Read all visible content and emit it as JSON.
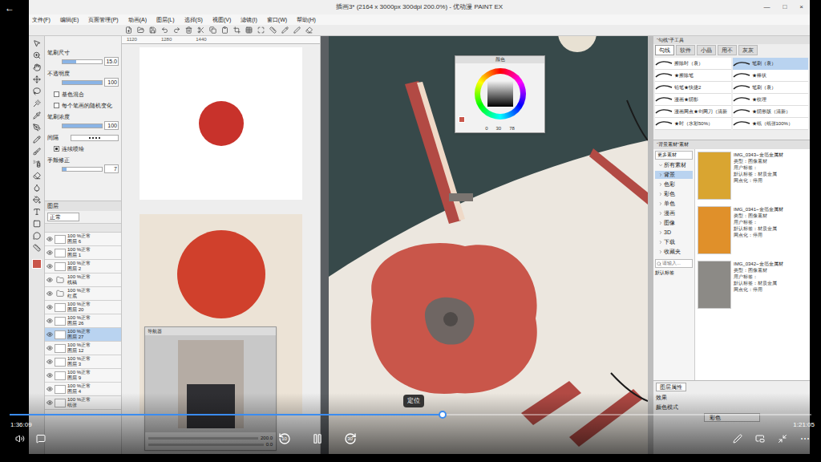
{
  "player": {
    "back": "←",
    "current_time": "1:36:09",
    "total_time": "1:21:05",
    "tooltip": "定位",
    "level": 0.54,
    "rewind_seconds": "10",
    "forward_seconds": "30",
    "more": "⋯"
  },
  "app": {
    "title": "插画3* (2164 x 3000px 300dpi 200.0%) - 优动漫 PAINT EX",
    "window_buttons": [
      "—",
      "□",
      "×"
    ],
    "menu": [
      "文件(F)",
      "编辑(E)",
      "页面管理(P)",
      "动画(A)",
      "图层(L)",
      "选择(S)",
      "视图(V)",
      "滤镜(I)",
      "窗口(W)",
      "帮助(H)"
    ]
  },
  "tool_property": {
    "rows": [
      {
        "kind": "slider",
        "label": "笔刷尺寸",
        "value": "15.0",
        "level": 0.35
      },
      {
        "kind": "slider",
        "label": "不透明度",
        "value": "100",
        "level": 1
      },
      {
        "kind": "checkbox",
        "label": "基色混合",
        "checked": false
      },
      {
        "kind": "checkbox",
        "label": "每个笔画的随机变化",
        "checked": false
      },
      {
        "kind": "slider",
        "label": "笔刷浓度",
        "value": "100",
        "level": 1
      },
      {
        "kind": "pattern",
        "label": "间隔"
      },
      {
        "kind": "checkbox",
        "label": "连续喷绘",
        "checked": true
      },
      {
        "kind": "slider",
        "label": "手颤修正",
        "value": "7",
        "level": 0.1
      }
    ]
  },
  "layers": {
    "title": "图层",
    "blend": "正常",
    "rows": [
      {
        "kind": "layer",
        "opacity": "100 %正常",
        "name": "图层 6",
        "visible": true,
        "selected": false
      },
      {
        "kind": "layer",
        "opacity": "100 %正常",
        "name": "图层 1",
        "visible": true,
        "selected": false
      },
      {
        "kind": "layer",
        "opacity": "100 %正常",
        "name": "图层 2",
        "visible": true,
        "selected": false
      },
      {
        "kind": "folder",
        "opacity": "100 %正常",
        "name": "线稿",
        "visible": true,
        "selected": false
      },
      {
        "kind": "folder",
        "opacity": "100 %正常",
        "name": "红底",
        "visible": true,
        "selected": false
      },
      {
        "kind": "layer",
        "opacity": "100 %正常",
        "name": "图层 20",
        "visible": true,
        "selected": false
      },
      {
        "kind": "layer",
        "opacity": "100 %正常",
        "name": "图层 26",
        "visible": true,
        "selected": false
      },
      {
        "kind": "layer",
        "opacity": "100 %正常",
        "name": "图层 27",
        "visible": true,
        "selected": true
      },
      {
        "kind": "layer",
        "opacity": "100 %正常",
        "name": "图层 12",
        "visible": true,
        "selected": false
      },
      {
        "kind": "layer",
        "opacity": "100 %正常",
        "name": "图层 3",
        "visible": true,
        "selected": false
      },
      {
        "kind": "layer",
        "opacity": "100 %正常",
        "name": "图层 9",
        "visible": true,
        "selected": false
      },
      {
        "kind": "layer",
        "opacity": "100 %正常",
        "name": "图层 4",
        "visible": true,
        "selected": false
      },
      {
        "kind": "layer",
        "opacity": "100 %正常",
        "name": "纸张",
        "visible": true,
        "selected": false
      }
    ]
  },
  "reference": {
    "ruler": [
      "1120",
      "1280",
      "1440"
    ]
  },
  "navigator": {
    "title": "导航器",
    "zoom": "200.0",
    "angle": "0.0"
  },
  "color_popup": {
    "title": "颜色",
    "values": [
      "0",
      "30",
      "78"
    ]
  },
  "subtool": {
    "title": "“勾线”子工具",
    "tabs": [
      {
        "label": "勾线",
        "selected": true
      },
      {
        "label": "软件",
        "selected": false
      },
      {
        "label": "小晶",
        "selected": false
      },
      {
        "label": "用不",
        "selected": false
      },
      {
        "label": "灰灰",
        "selected": false
      }
    ],
    "brushes": [
      {
        "name": "擦除时（衰）",
        "selected": false
      },
      {
        "name": "笔刷（衰）",
        "selected": true
      },
      {
        "name": "★擦除笔",
        "selected": false
      },
      {
        "name": "★棒状",
        "selected": false
      },
      {
        "name": "铅笔★快捷2",
        "selected": false
      },
      {
        "name": "笔刷（衰）",
        "selected": false
      },
      {
        "name": "漫画★阴影",
        "selected": false
      },
      {
        "name": "★纹理",
        "selected": false
      },
      {
        "name": "漫画网点★剑网刀（清新",
        "selected": false
      },
      {
        "name": "★阴形版（清新）",
        "selected": false
      },
      {
        "name": "★时（水彩50%）",
        "selected": false
      },
      {
        "name": "★纸（纸张100%）",
        "selected": false
      }
    ]
  },
  "materials": {
    "title": "“背景素材”素材",
    "more": "更多素材",
    "tree": [
      {
        "label": "所有素材",
        "expanded": true,
        "selected": false
      },
      {
        "label": "背景",
        "expanded": false,
        "selected": true
      },
      {
        "label": "色彩",
        "expanded": false,
        "selected": false
      },
      {
        "label": "彩色",
        "expanded": false,
        "selected": false
      },
      {
        "label": "单色",
        "expanded": false,
        "selected": false
      },
      {
        "label": "漫画",
        "expanded": false,
        "selected": false
      },
      {
        "label": "图像",
        "expanded": false,
        "selected": false
      },
      {
        "label": "3D",
        "expanded": false,
        "selected": false
      },
      {
        "label": "下载",
        "expanded": false,
        "selected": false
      },
      {
        "label": "收藏夹",
        "expanded": false,
        "selected": false
      }
    ],
    "search_placeholder": "请输入...",
    "default_tag": "默认标签",
    "items": [
      {
        "name": "IMG_0343~金箔金属材",
        "type": "类型：图像素材",
        "user_tag": "用户标签：",
        "default_tag": "默认标签：材质金属",
        "screen": "网点化：停用",
        "color": "#d9a531"
      },
      {
        "name": "IMG_0341~金箔金属材",
        "type": "类型：图像素材",
        "user_tag": "用户标签：",
        "default_tag": "默认标签：材质金属",
        "screen": "网点化：停用",
        "color": "#e0902a"
      },
      {
        "name": "IMG_0342~金箔金属材",
        "type": "类型：图像素材",
        "user_tag": "用户标签：",
        "default_tag": "默认标签：材质金属",
        "screen": "网点化：停用",
        "color": "#8c8a86"
      }
    ]
  },
  "bottom_panel": {
    "tab": "图层属性",
    "label": "效果",
    "mode_label": "颜色模式",
    "mode_value": "彩色"
  }
}
